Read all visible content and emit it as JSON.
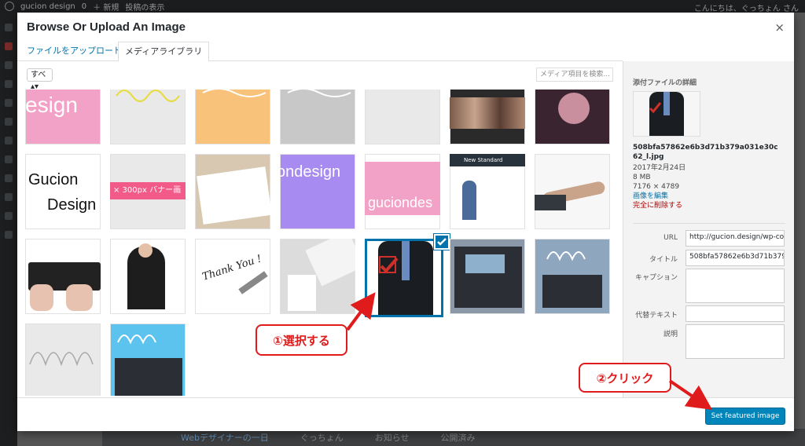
{
  "adminbar": {
    "site": "gucion design",
    "comments": "0",
    "new": "＋ 新規",
    "view": "投稿の表示",
    "greeting": "こんにちは、ぐっちょん さん"
  },
  "modal": {
    "title": "Browse Or Upload An Image",
    "close": "×",
    "tabs": {
      "upload": "ファイルをアップロード",
      "library": "メディアライブラリ"
    },
    "filter": "すべ ▴▾",
    "search_placeholder": "メディア項目を検索..."
  },
  "thumbs": {
    "r0c0": "esign",
    "r1c0a": "Gucion",
    "r1c0b": "Design",
    "r1c1": "× 300px バナー画",
    "r1c3": "ondesign",
    "r1c4": "guciondes",
    "r1c5": "New Standard",
    "r2c2": "Thank You !"
  },
  "sidebar": {
    "title": "添付ファイルの詳細",
    "filename": "508bfa57862e6b3d71b379a031e30c62_l.jpg",
    "date": "2017年2月24日",
    "size": "8 MB",
    "dims": "7176 × 4789",
    "edit": "画像を編集",
    "delete": "完全に削除する",
    "url_label": "URL",
    "url_value": "http://gucion.design/wp-co",
    "title_label": "タイトル",
    "title_value": "508bfa57862e6b3d71b379",
    "caption_label": "キャプション",
    "alt_label": "代替テキスト",
    "desc_label": "説明"
  },
  "button": {
    "featured": "Set featured image"
  },
  "annotations": {
    "step1": "①選択する",
    "step2": "②クリック"
  },
  "bgrow": {
    "title": "Webデザイナーの一日",
    "author": "ぐっちょん",
    "cat": "お知らせ",
    "status": "公開済み"
  },
  "colors": {
    "accent": "#0085ba",
    "annotation": "#e01b1b",
    "pink": "#f0a0c4",
    "purple": "#a78bf0"
  }
}
